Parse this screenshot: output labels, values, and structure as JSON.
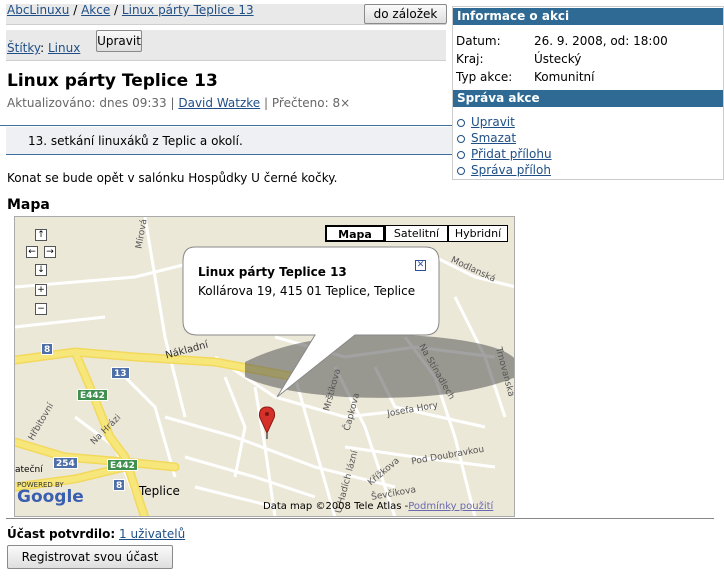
{
  "breadcrumb": {
    "items": [
      "AbcLinuxu",
      "Akce",
      "Linux párty Teplice 13"
    ],
    "separator": "/"
  },
  "toolbar": {
    "bookmark_label": "do záložek",
    "edit_label": "Upravit"
  },
  "tags": {
    "label": "Štítky",
    "colon": ":",
    "items": [
      "Linux"
    ]
  },
  "article": {
    "title": "Linux párty Teplice 13",
    "updated_label": "Aktualizováno: dnes 09:33",
    "divider": "|",
    "author": "David Watzke",
    "read_label": "Přečteno: 8×",
    "perex": "13. setkání linuxáků z Teplic a okolí.",
    "body": "Konat se bude opět v salónku Hospůdky U černé kočky.",
    "map_heading": "Mapa"
  },
  "event_info": {
    "heading": "Informace o akci",
    "rows": [
      {
        "label": "Datum:",
        "value": "26. 9. 2008, od: 18:00"
      },
      {
        "label": "Kraj:",
        "value": "Ústecký"
      },
      {
        "label": "Typ akce:",
        "value": "Komunitní"
      }
    ]
  },
  "admin": {
    "heading": "Správa akce",
    "links": [
      "Upravit",
      "Smazat",
      "Přidat přílohu",
      "Správa příloh"
    ]
  },
  "map": {
    "types": [
      "Mapa",
      "Satelitní",
      "Hybridní"
    ],
    "selected_type": "Mapa",
    "nav": {
      "up": "↑",
      "left": "←",
      "right": "→",
      "down": "↓",
      "zoom_in": "+",
      "zoom_out": "−"
    },
    "popup": {
      "title": "Linux párty Teplice 13",
      "address": "Kollárova 19, 415 01 Teplice, Teplice",
      "close": "✕"
    },
    "street_labels": [
      "Mírová",
      "Nákladní",
      "Hřbitovní",
      "Na Hrázi",
      "Modlanská",
      "Trnovanská",
      "Josefa Hory",
      "Pod Doubravkou",
      "Křížkova",
      "Ševčíkova",
      "Mrštíkova",
      "Čapkova",
      "Na Stínadlech",
      "ateční",
      "U Hadích lázní"
    ],
    "city_label": "Teplice",
    "shields": [
      "8",
      "13",
      "E442",
      "254",
      "E442",
      "8"
    ],
    "powered_by": "POWERED BY",
    "google_logo": "Google",
    "copyright": "Data map ©2008 Tele Atlas -",
    "terms_link": "Podmínky použití",
    "colors": {
      "road_major": "#f7e77a",
      "road_minor": "#ffffff",
      "land": "#ece8d8",
      "shield": "#4e6fa8",
      "shield_green": "#3f8f4f"
    }
  },
  "attendance": {
    "label": "Účast potvrdilo:",
    "count_link": "1 uživatelů",
    "register_label": "Registrovat svou účast"
  }
}
